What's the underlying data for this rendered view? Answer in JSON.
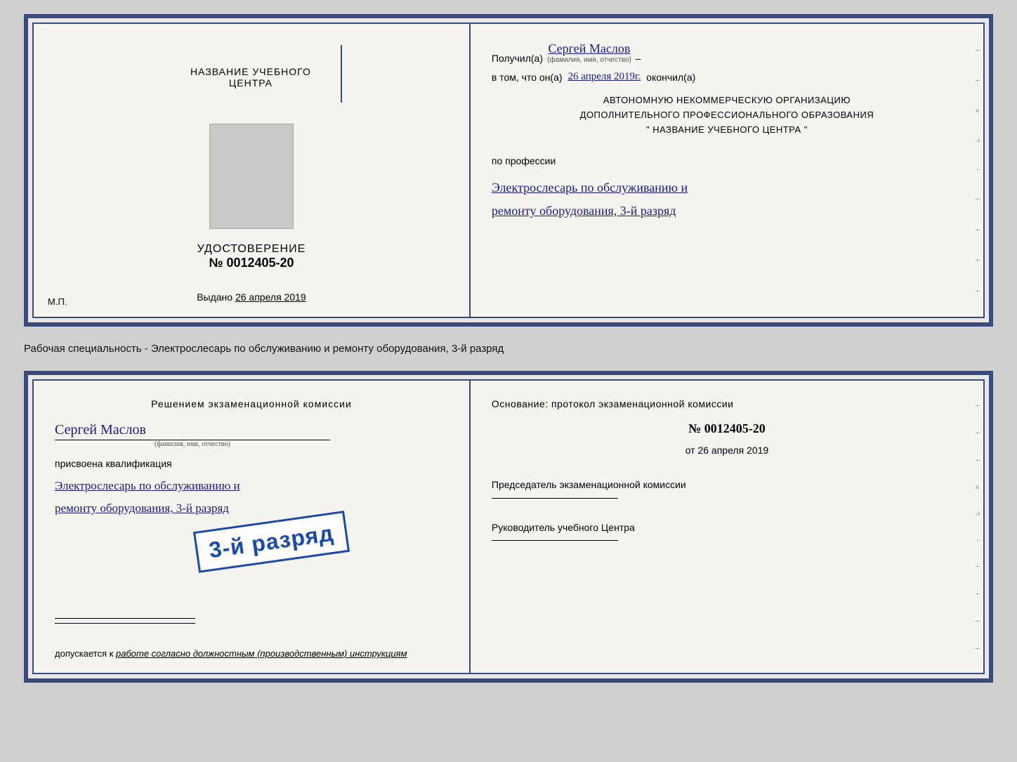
{
  "doc1": {
    "left": {
      "org_title": "НАЗВАНИЕ УЧЕБНОГО ЦЕНТРА",
      "udostoverenie_label": "УДОСТОВЕРЕНИЕ",
      "number_prefix": "№",
      "number_value": "0012405-20",
      "vydano_label": "Выдано",
      "vydano_date": "26 апреля 2019",
      "mp_label": "М.П."
    },
    "right": {
      "poluchil_label": "Получил(а)",
      "poluchil_name": "Сергей Маслов",
      "fio_note": "(фамилия, имя, отчество)",
      "dash": "–",
      "vtom_label": "в том, что он(а)",
      "vtom_date": "26 апреля 2019г.",
      "okonchil_label": "окончил(а)",
      "org_line1": "АВТОНОМНУЮ НЕКОММЕРЧЕСКУЮ ОРГАНИЗАЦИЮ",
      "org_line2": "ДОПОЛНИТЕЛЬНОГО ПРОФЕССИОНАЛЬНОГО ОБРАЗОВАНИЯ",
      "org_line3": "\"  НАЗВАНИЕ УЧЕБНОГО ЦЕНТРА  \"",
      "po_professii_label": "по профессии",
      "profession_line1": "Электрослесарь по обслуживанию и",
      "profession_line2": "ремонту оборудования, 3-й разряд"
    }
  },
  "label_text": "Рабочая специальность - Электрослесарь по обслуживанию и ремонту оборудования, 3-й разряд",
  "doc2": {
    "left": {
      "decision_title": "Решением экзаменационной комиссии",
      "name_handwritten": "Сергей Маслов",
      "fio_note": "(фамилия, имя, отчество)",
      "prisvoena_label": "присвоена квалификация",
      "kvalif_line1": "Электрослесарь по обслуживанию и",
      "kvalif_line2": "ремонту оборудования, 3-й разряд",
      "stamp_text": "3-й разряд",
      "dopuskaetsya_label": "допускается к",
      "dopuskaetsya_value": "работе согласно должностным (производственным) инструкциям"
    },
    "right": {
      "osnovanie_label": "Основание: протокол экзаменационной комиссии",
      "number_prefix": "№",
      "number_value": "0012405-20",
      "ot_label": "от",
      "ot_date": "26 апреля 2019",
      "predsedatel_label": "Председатель экзаменационной комиссии",
      "rukovoditel_label": "Руководитель учебного Центра"
    }
  }
}
